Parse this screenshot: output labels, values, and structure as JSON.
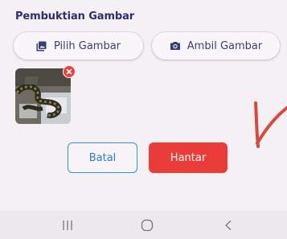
{
  "section": {
    "title": "Pembuktian Gambar"
  },
  "buttons": {
    "pick_label": "Pilih Gambar",
    "take_label": "Ambil Gambar",
    "cancel_label": "Batal",
    "submit_label": "Hantar"
  },
  "icons": {
    "pick": "image-icon",
    "take": "camera-icon",
    "remove": "close-icon",
    "nav_recent": "recent-apps-icon",
    "nav_home": "home-icon",
    "nav_back": "back-icon"
  },
  "colors": {
    "title": "#2c2f6e",
    "accent_blue": "#3b8fd0",
    "submit_red": "#ea3d39",
    "remove_red": "#e8413a",
    "annotation_red": "#d64a3f"
  }
}
